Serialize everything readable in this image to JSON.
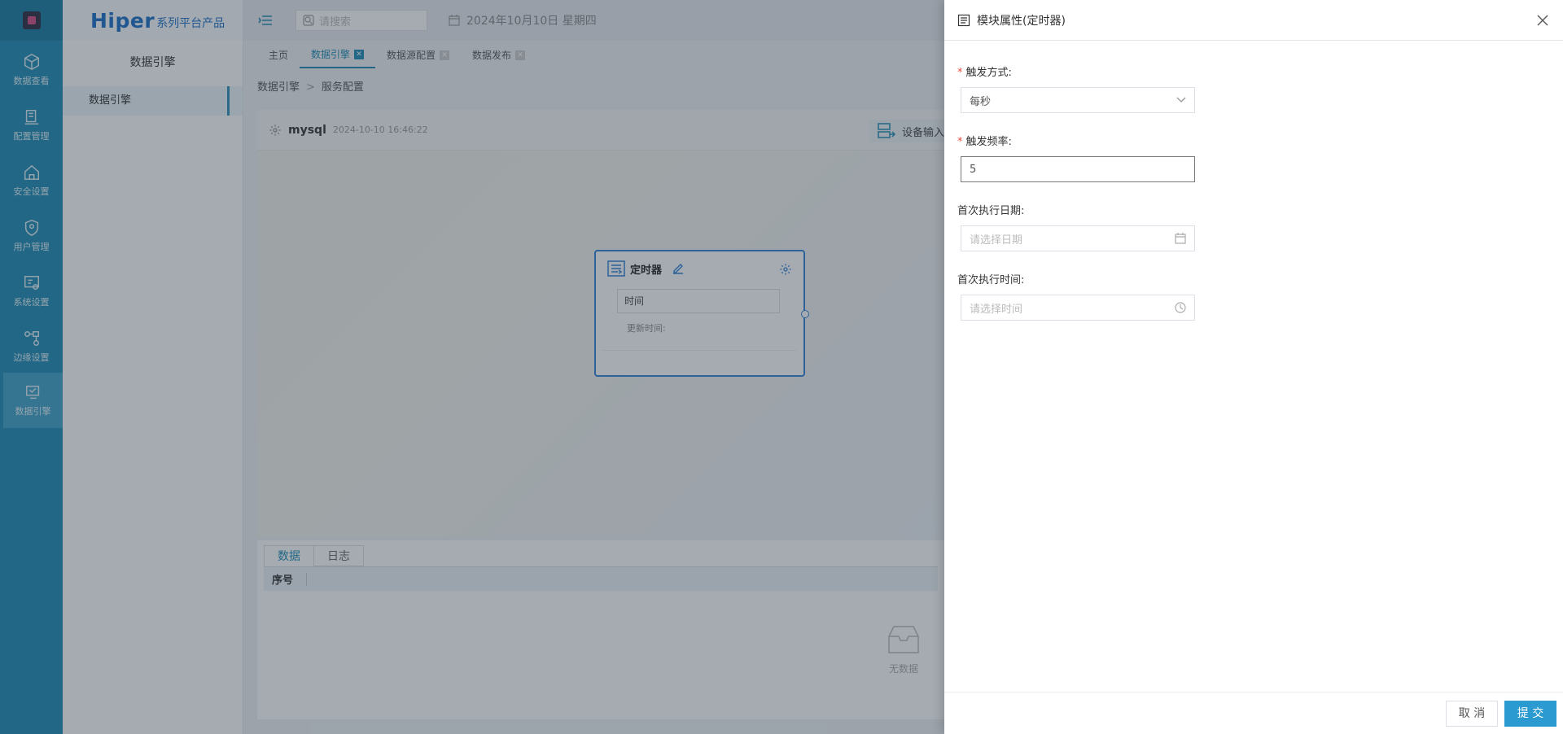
{
  "rail": {
    "items": [
      {
        "label": "数据查看",
        "icon": "cube-icon"
      },
      {
        "label": "配置管理",
        "icon": "config-icon"
      },
      {
        "label": "安全设置",
        "icon": "home-shield-icon"
      },
      {
        "label": "用户管理",
        "icon": "user-shield-icon"
      },
      {
        "label": "系统设置",
        "icon": "system-settings-icon"
      },
      {
        "label": "边缘设置",
        "icon": "edge-icon"
      },
      {
        "label": "数据引擎",
        "icon": "data-engine-icon"
      }
    ]
  },
  "brand": {
    "name": "Hiper",
    "sub": "系列平台产品"
  },
  "sidebar": {
    "title": "数据引擎",
    "item": "数据引擎"
  },
  "header": {
    "search_placeholder": "请搜索",
    "date": "2024年10月10日 星期四"
  },
  "tabs": [
    {
      "label": "主页"
    },
    {
      "label": "数据引擎"
    },
    {
      "label": "数据源配置"
    },
    {
      "label": "数据发布"
    }
  ],
  "breadcrumb": {
    "root": "数据引擎",
    "sep": ">",
    "current": "服务配置"
  },
  "workspace": {
    "name": "mysql",
    "timestamp": "2024-10-10 16:46:22",
    "device_input": "设备输入"
  },
  "node": {
    "title": "定时器",
    "field": "时间",
    "updated_label": "更新时间:"
  },
  "bottom": {
    "tabs": [
      "数据",
      "日志"
    ],
    "column": "序号",
    "empty": "无数据"
  },
  "drawer": {
    "title": "模块属性(定时器)",
    "fields": {
      "trigger_mode": {
        "label": "触发方式:",
        "value": "每秒"
      },
      "trigger_freq": {
        "label": "触发频率:",
        "value": "5"
      },
      "first_date": {
        "label": "首次执行日期:",
        "placeholder": "请选择日期"
      },
      "first_time": {
        "label": "首次执行时间:",
        "placeholder": "请选择时间"
      }
    },
    "cancel": "取 消",
    "submit": "提 交"
  }
}
